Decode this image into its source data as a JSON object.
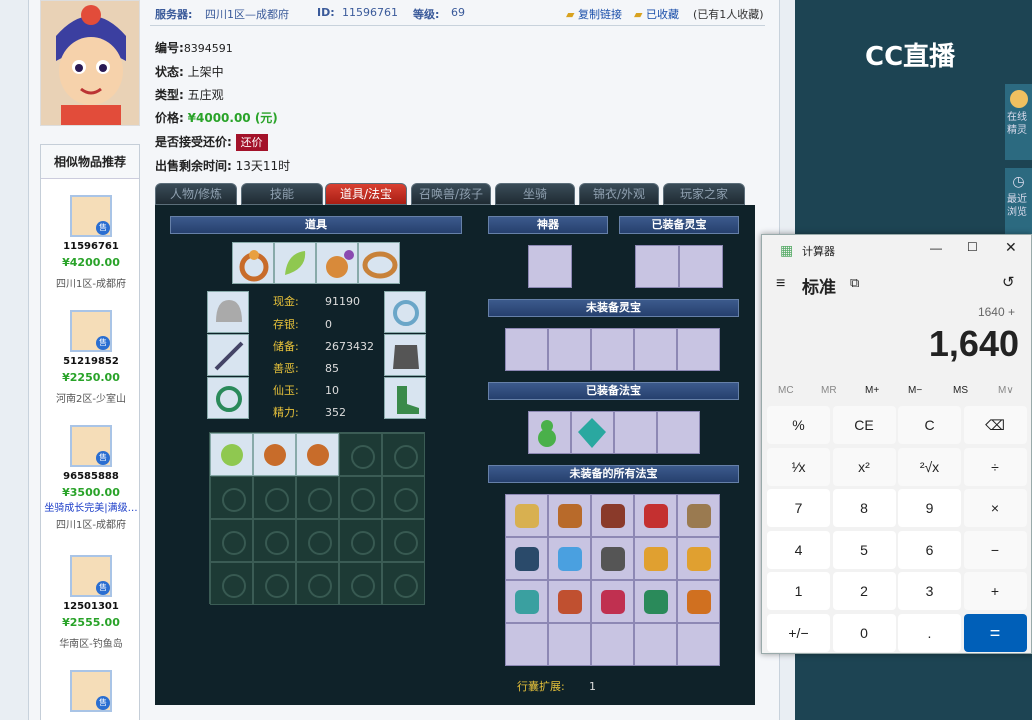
{
  "topbar": {
    "server_label": "服务器:",
    "server": "四川1区—成都府",
    "id_label": "ID:",
    "id": "11596761",
    "level_label": "等级:",
    "level": "69",
    "copy_link": "复制链接",
    "favorited": "已收藏",
    "fav_count": "(已有1人收藏)"
  },
  "info": {
    "no_label": "编号:",
    "no": "8394591",
    "status_label": "状态:",
    "status": "上架中",
    "type_label": "类型:",
    "type": "五庄观",
    "price_label": "价格:",
    "price": "¥4000.00 (元)",
    "counter_label": "是否接受还价:",
    "counter_button": "还价",
    "remain_label": "出售剩余时间:",
    "remain": "13天11时"
  },
  "recommend": {
    "title": "相似物品推荐",
    "badge": "售",
    "items": [
      {
        "id": "11596761",
        "price": "¥4200.00",
        "area": "四川1区-成都府",
        "note": ""
      },
      {
        "id": "51219852",
        "price": "¥2250.00",
        "area": "河南2区-少室山",
        "note": ""
      },
      {
        "id": "96585888",
        "price": "¥3500.00",
        "area": "四川1区-成都府",
        "note": "坐骑成长完美|满级…"
      },
      {
        "id": "12501301",
        "price": "¥2555.00",
        "area": "华南区-钓鱼岛",
        "note": ""
      }
    ]
  },
  "tabs": [
    "人物/修炼",
    "技能",
    "道具/法宝",
    "召唤兽/孩子",
    "坐骑",
    "锦衣/外观",
    "玩家之家"
  ],
  "panel": {
    "items_header": "道具",
    "shenqi_header": "神器",
    "equipped_lingbao_header": "已装备灵宝",
    "unequipped_lingbao_header": "未装备灵宝",
    "equipped_fabao_header": "已装备法宝",
    "all_fabao_header": "未装备的所有法宝",
    "stats": [
      {
        "k": "现金:",
        "v": "91190"
      },
      {
        "k": "存银:",
        "v": "0"
      },
      {
        "k": "储备:",
        "v": "2673432"
      },
      {
        "k": "善恶:",
        "v": "85"
      },
      {
        "k": "仙玉:",
        "v": "10"
      },
      {
        "k": "精力:",
        "v": "352"
      }
    ],
    "bag_ext_label": "行囊扩展:",
    "bag_ext": "1"
  },
  "cc": {
    "logo": "CC直播",
    "side1": "在线精灵",
    "side2": "最近浏览"
  },
  "calc": {
    "title": "计算器",
    "mode": "标准",
    "expression": "1640 +",
    "display": "1,640",
    "memory": [
      "MC",
      "MR",
      "M+",
      "M−",
      "MS",
      "M∨"
    ],
    "keys": [
      "%",
      "CE",
      "C",
      "⌫",
      "¹⁄x",
      "x²",
      "²√x",
      "÷",
      "7",
      "8",
      "9",
      "×",
      "4",
      "5",
      "6",
      "−",
      "1",
      "2",
      "3",
      "+",
      "+/−",
      "0",
      ".",
      "="
    ]
  },
  "colors": {
    "accent": "#005fb8",
    "active_tab": "#c9302c",
    "price_green": "#29a329"
  }
}
